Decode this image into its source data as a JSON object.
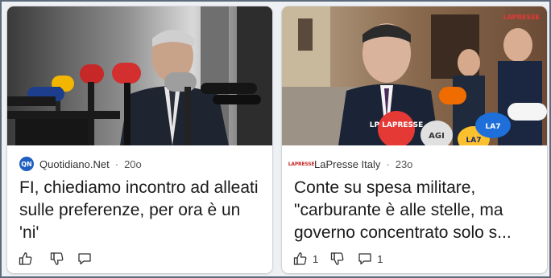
{
  "cards": [
    {
      "source": "Quotidiano.Net",
      "logo_text": "QN",
      "separator": "·",
      "age": "20o",
      "headline": "FI, chiediamo incontro ad alleati sulle preferenze, per ora è un 'ni'",
      "like_count": "",
      "comment_count": ""
    },
    {
      "source": "LaPresse Italy",
      "logo_text": "LAPRESSE",
      "separator": "·",
      "age": "23o",
      "headline": "Conte su spesa militare, \"carburante è alle stelle, ma governo concentrato solo s...",
      "like_count": "1",
      "comment_count": "1",
      "image_watermark": "LAPRESSE",
      "mic_labels": [
        "LP LAPRESSE",
        "AGI",
        "LA7",
        "LA7"
      ]
    }
  ]
}
